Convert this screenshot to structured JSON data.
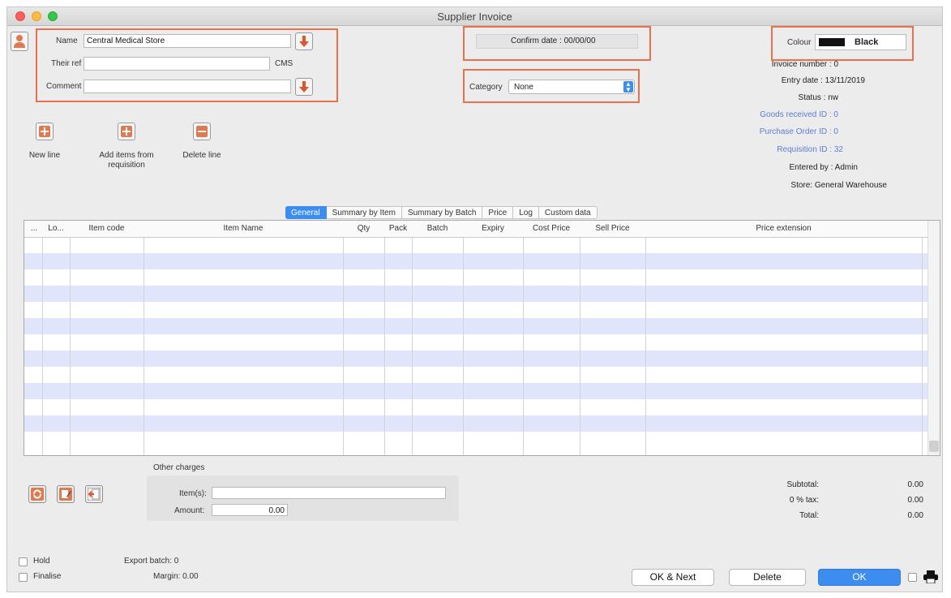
{
  "window": {
    "title": "Supplier Invoice"
  },
  "supplier": {
    "name_label": "Name",
    "name_value": "Central Medical Store",
    "their_ref_label": "Their ref",
    "their_ref_value": "",
    "their_ref_code": "CMS",
    "comment_label": "Comment",
    "comment_value": ""
  },
  "confirm_date": {
    "label": "Confirm date : 00/00/00"
  },
  "category": {
    "label": "Category",
    "selected": "None"
  },
  "colour": {
    "label": "Colour",
    "value": "Black",
    "swatch": "#111111"
  },
  "info": {
    "invoice_number": "Invoice number : 0",
    "entry_date": "Entry date : 13/11/2019",
    "status": "Status : nw",
    "goods_received": "Goods received ID : 0",
    "purchase_order": "Purchase Order ID : 0",
    "requisition": "Requisition ID : 32",
    "entered_by": "Entered by : Admin",
    "store": "Store: General Warehouse"
  },
  "toolbar": {
    "new_line": "New line",
    "add_items": "Add items from requisition",
    "delete_line": "Delete line"
  },
  "tabs": [
    "General",
    "Summary by Item",
    "Summary by Batch",
    "Price",
    "Log",
    "Custom data"
  ],
  "table": {
    "columns": [
      "...",
      "Lo...",
      "Item code",
      "Item Name",
      "Qty",
      "Pack",
      "Batch",
      "Expiry",
      "Cost Price",
      "Sell Price",
      "Price extension"
    ],
    "rows": []
  },
  "other_charges": {
    "title": "Other charges",
    "items_label": "Item(s):",
    "items_value": "",
    "amount_label": "Amount:",
    "amount_value": "0.00"
  },
  "totals": {
    "subtotal_label": "Subtotal:",
    "subtotal_value": "0.00",
    "tax_label": "0 % tax:",
    "tax_value": "0.00",
    "total_label": "Total:",
    "total_value": "0.00"
  },
  "footer": {
    "hold_label": "Hold",
    "finalise_label": "Finalise",
    "export_batch": "Export batch: 0",
    "margin": "Margin: 0.00",
    "ok_next": "OK & Next",
    "delete": "Delete",
    "ok": "OK"
  },
  "colors": {
    "accent": "#3d8cf0",
    "highlight": "#e8734a",
    "row_alt": "#dfe6fb"
  }
}
